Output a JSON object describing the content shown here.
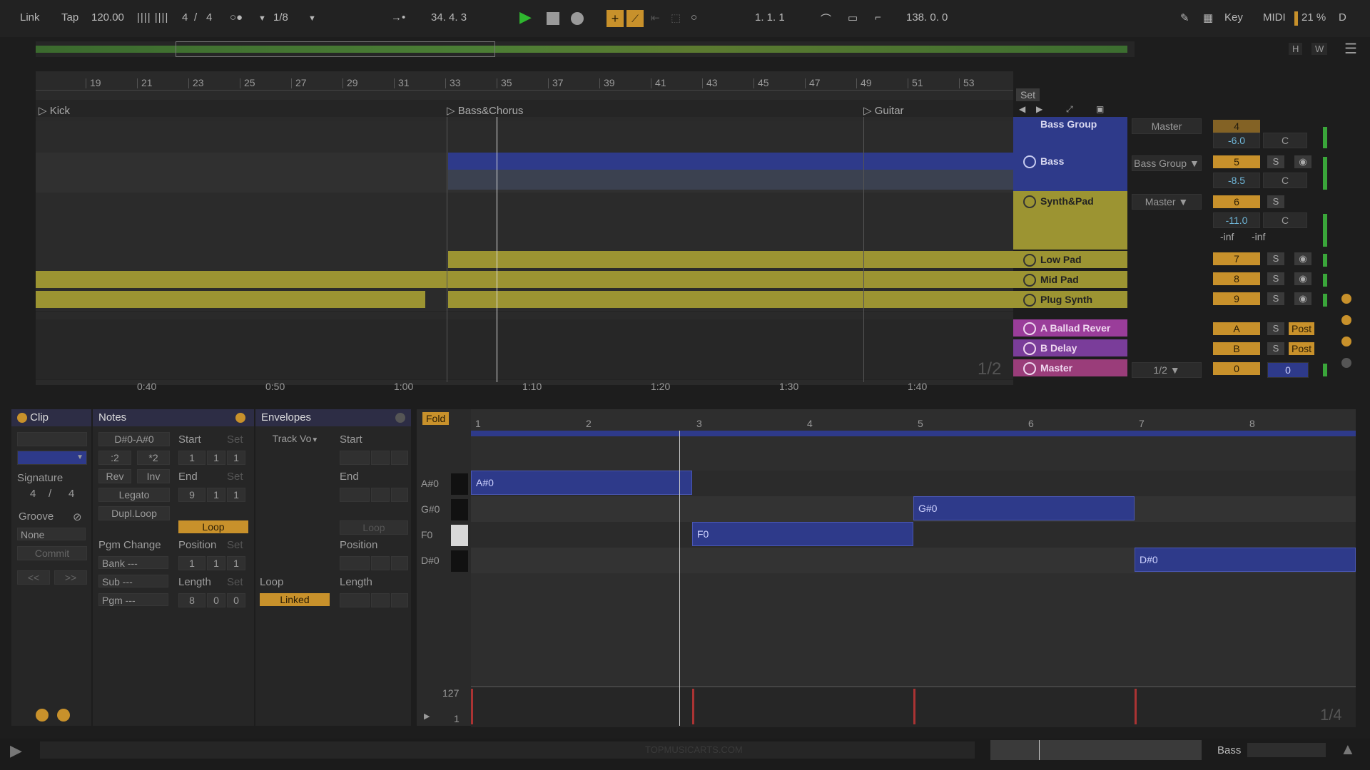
{
  "transport": {
    "link": "Link",
    "tap": "Tap",
    "tempo": "120.00",
    "signature_num": "4",
    "signature_den": "4",
    "quantize": "1/8",
    "position": "34.   4.   3",
    "loop_start": "1.   1.   1",
    "loop_length": "138.   0.   0",
    "key": "Key",
    "midi": "MIDI",
    "cpu": "21 %",
    "d": "D"
  },
  "overview": {
    "h": "H",
    "w": "W"
  },
  "ruler": [
    "19",
    "21",
    "23",
    "25",
    "27",
    "29",
    "31",
    "33",
    "35",
    "37",
    "39",
    "41",
    "43",
    "45",
    "47",
    "49",
    "51",
    "53"
  ],
  "locators": [
    {
      "label": "Kick"
    },
    {
      "label": "Bass&Chorus"
    },
    {
      "label": "Guitar"
    }
  ],
  "set_label": "Set",
  "times": [
    "0:40",
    "0:50",
    "1:00",
    "1:10",
    "1:20",
    "1:30",
    "1:40"
  ],
  "zoom_ratio": "1/2",
  "mixer": [
    {
      "name": "Bass Group",
      "route": "Master",
      "vol": "-6.0",
      "pan": "C",
      "num": "4"
    },
    {
      "name": "Bass",
      "route": "Bass Group",
      "vol": "-8.5",
      "pan": "C",
      "num": "5",
      "s": "S"
    },
    {
      "name": "Synth&Pad",
      "route": "Master",
      "vol": "-11.0",
      "pan": "C",
      "num": "6",
      "s": "S",
      "inf1": "-inf",
      "inf2": "-inf"
    },
    {
      "name": "Low Pad",
      "num": "7",
      "s": "S"
    },
    {
      "name": "Mid Pad",
      "num": "8",
      "s": "S"
    },
    {
      "name": "Plug Synth",
      "num": "9",
      "s": "S"
    },
    {
      "name": "A Ballad Rever",
      "num": "A",
      "s": "S",
      "post": "Post"
    },
    {
      "name": "B Delay",
      "num": "B",
      "s": "S",
      "post": "Post"
    },
    {
      "name": "Master",
      "route": "1/2",
      "num": "0",
      "vol": "0"
    }
  ],
  "clip_panel": {
    "title": "Clip",
    "signature_label": "Signature",
    "sig_num": "4",
    "sig_den": "4",
    "groove_label": "Groove",
    "groove_value": "None",
    "commit": "Commit",
    "prev": "<<",
    "next": ">>"
  },
  "notes_panel": {
    "title": "Notes",
    "range": "D#0-A#0",
    "half": ":2",
    "double": "*2",
    "rev": "Rev",
    "inv": "Inv",
    "legato": "Legato",
    "dupl": "Dupl.Loop",
    "start_label": "Start",
    "set": "Set",
    "start": [
      "1",
      "1",
      "1"
    ],
    "end_label": "End",
    "end": [
      "9",
      "1",
      "1"
    ],
    "loop": "Loop",
    "pgm_change": "Pgm Change",
    "bank": "Bank ---",
    "sub": "Sub ---",
    "pgm": "Pgm ---",
    "position_label": "Position",
    "position": [
      "1",
      "1",
      "1"
    ],
    "length_label": "Length",
    "length": [
      "8",
      "0",
      "0"
    ]
  },
  "envelopes_panel": {
    "title": "Envelopes",
    "track_vol": "Track Vo",
    "start_label": "Start",
    "end_label": "End",
    "loop_btn": "Loop",
    "position_label": "Position",
    "loop_label": "Loop",
    "length_label": "Length",
    "linked": "Linked"
  },
  "roll": {
    "fold": "Fold",
    "bars": [
      "1",
      "2",
      "3",
      "4",
      "5",
      "6",
      "7",
      "8"
    ],
    "keys": [
      "A#0",
      "G#0",
      "F0",
      "D#0"
    ],
    "notes": [
      {
        "label": "A#0"
      },
      {
        "label": "G#0"
      },
      {
        "label": "F0"
      },
      {
        "label": "D#0"
      }
    ],
    "vel_max": "127",
    "vel_min": "1",
    "grid": "1/4"
  },
  "status": {
    "watermark": "TOPMUSICARTS.COM",
    "track": "Bass"
  }
}
